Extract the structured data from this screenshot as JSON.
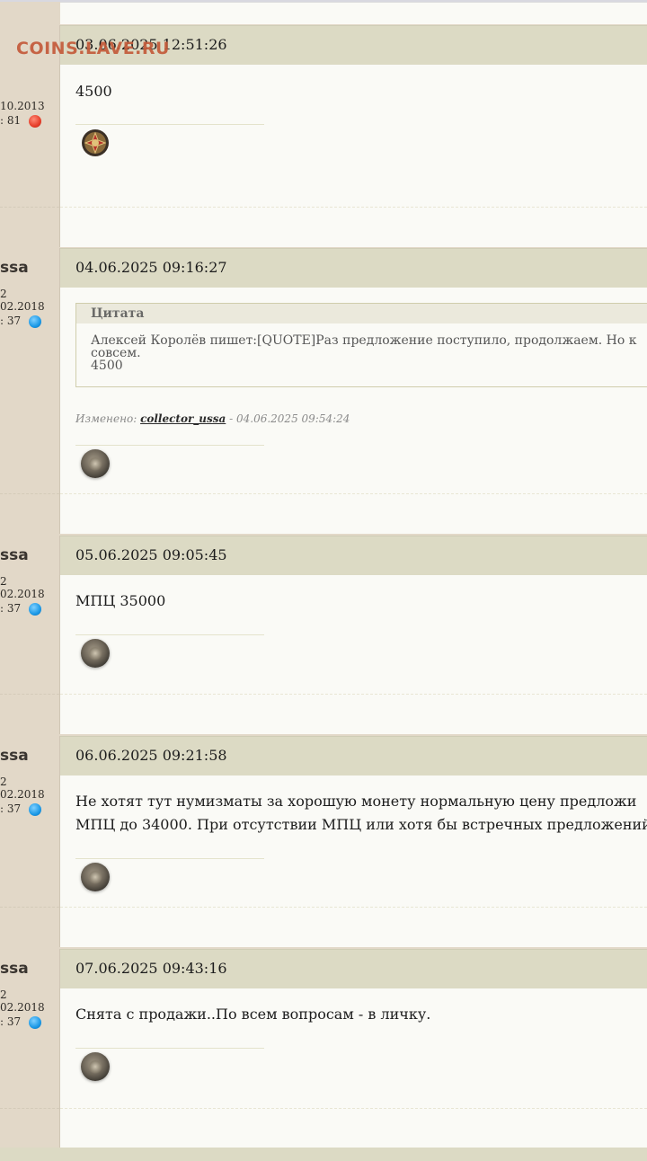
{
  "watermark": "COINS.LAVE.RU",
  "posts": [
    {
      "date": "03.06.2025 12:51:26",
      "side": {
        "uname": "",
        "line1": "",
        "line2": "10.2013",
        "line3": ": 81",
        "status": "red"
      },
      "text": [
        "4500"
      ],
      "sig": "order-icon"
    },
    {
      "date": "04.06.2025 09:16:27",
      "side": {
        "uname": "ssa",
        "line1": "2",
        "line2": "02.2018",
        "line3": ": 37",
        "status": "blue"
      },
      "quote": {
        "title": "Цитата",
        "lines": [
          "Алексей Королёв пишет:[QUOTE]Раз предложение поступило, продолжаем. Но к",
          "совсем.",
          "4500"
        ]
      },
      "edited_prefix": "Изменено: ",
      "edited_user": "collector_ussa",
      "edited_suffix": " - 04.06.2025 09:54:24",
      "sig": "coin-icon"
    },
    {
      "date": "05.06.2025 09:05:45",
      "side": {
        "uname": "ssa",
        "line1": "2",
        "line2": "02.2018",
        "line3": ": 37",
        "status": "blue"
      },
      "text": [
        "МПЦ 35000"
      ],
      "sig": "coin-icon"
    },
    {
      "date": "06.06.2025 09:21:58",
      "side": {
        "uname": "ssa",
        "line1": "2",
        "line2": "02.2018",
        "line3": ": 37",
        "status": "blue"
      },
      "text": [
        "Не хотят тут нумизматы за хорошую монету нормальную цену предложи",
        "МПЦ до 34000. При отсутствии МПЦ или хотя бы встречных предложений"
      ],
      "sig": "coin-icon"
    },
    {
      "date": "07.06.2025 09:43:16",
      "side": {
        "uname": "ssa",
        "line1": "2",
        "line2": "02.2018",
        "line3": ": 37",
        "status": "blue"
      },
      "text": [
        "Снята с продажи..По всем вопросам - в личку."
      ],
      "sig": "coin-icon"
    }
  ]
}
